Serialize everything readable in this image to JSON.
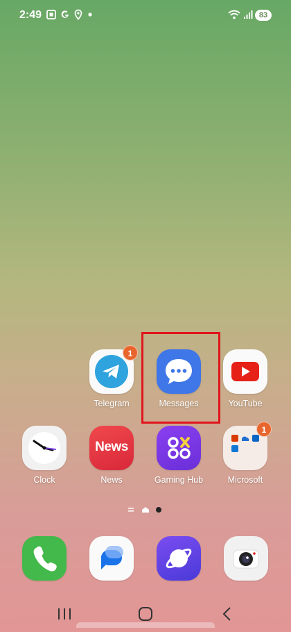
{
  "status_bar": {
    "time": "2:49",
    "battery": "83",
    "icons": [
      "screenshot-icon",
      "google-icon",
      "location-icon",
      "dot-icon",
      "wifi-icon",
      "signal-icon"
    ]
  },
  "apps_row1": [
    {
      "label": "Telegram",
      "badge": "1",
      "icon": "telegram-icon"
    },
    {
      "label": "Messages",
      "badge": "",
      "icon": "messages-icon"
    },
    {
      "label": "YouTube",
      "badge": "",
      "icon": "youtube-icon"
    }
  ],
  "apps_row2": [
    {
      "label": "Clock",
      "badge": "",
      "icon": "clock-icon"
    },
    {
      "label": "News",
      "badge": "",
      "icon": "news-icon",
      "icon_text": "News"
    },
    {
      "label": "Gaming Hub",
      "badge": "",
      "icon": "gaming-hub-icon"
    },
    {
      "label": "Microsoft",
      "badge": "1",
      "icon": "microsoft-folder-icon"
    }
  ],
  "dock": [
    "phone-icon",
    "chat-icon",
    "internet-icon",
    "camera-icon"
  ],
  "navbar": [
    "recents-icon",
    "home-icon",
    "back-icon"
  ],
  "highlight": {
    "target": "Messages",
    "color": "#e0141b"
  },
  "colors": {
    "telegram": "#2ea3dd",
    "messages": "#3f76e8",
    "youtube": "#e62117",
    "news": "#e6343c",
    "gaming": "#7a3ce6",
    "phone": "#43b84b",
    "badge": "#e8662e"
  }
}
